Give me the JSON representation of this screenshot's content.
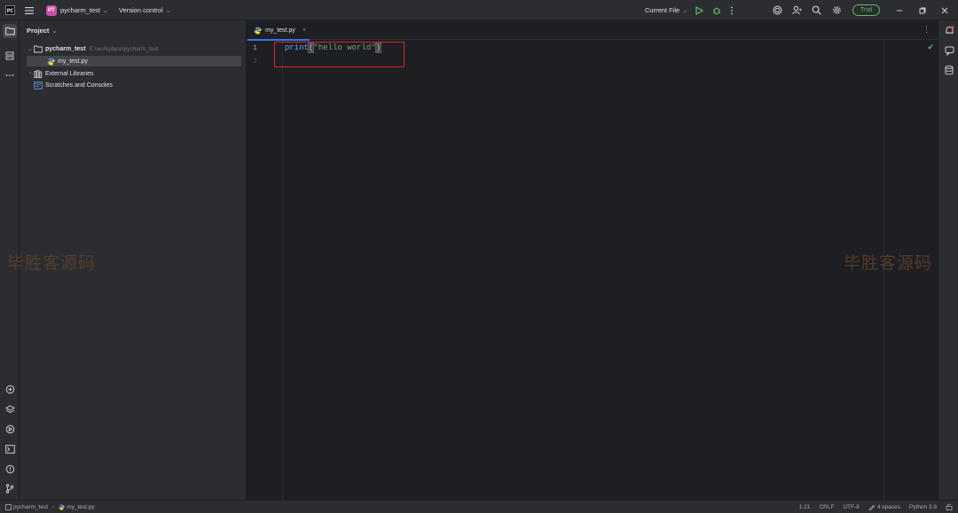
{
  "titlebar": {
    "project_badge": "PT",
    "project_name": "pycharm_test",
    "version_control": "Version control",
    "run_config": "Current File",
    "trial": "Trial"
  },
  "project_panel": {
    "title": "Project",
    "tree": [
      {
        "label": "pycharm_test",
        "path": "E:\\workplace\\pycharm_test",
        "icon": "folder-icon",
        "expanded": true
      },
      {
        "label": "my_test.py",
        "icon": "python-file-icon",
        "selected": true
      },
      {
        "label": "External Libraries",
        "icon": "library-icon",
        "expanded": false
      },
      {
        "label": "Scratches and Consoles",
        "icon": "scratches-icon"
      }
    ]
  },
  "editor": {
    "tab": "my_test.py",
    "tab_close": "×",
    "line_numbers": [
      "1",
      "2"
    ],
    "code": {
      "fn": "print",
      "open_paren": "(",
      "string": "\"hello world\"",
      "close_paren": ")"
    }
  },
  "statusbar": {
    "breadcrumb": [
      "pycharm_test",
      "my_test.py"
    ],
    "position": "1:21",
    "line_sep": "CRLF",
    "encoding": "UTF-8",
    "indent": "4 spaces",
    "interpreter": "Python 3.8"
  },
  "watermark": "毕胜客源码",
  "colors": {
    "background": "#1e1f22",
    "panel": "#2b2d30",
    "accent": "#3574f0",
    "success": "#5fb865",
    "highlight_box": "#e0202a"
  }
}
